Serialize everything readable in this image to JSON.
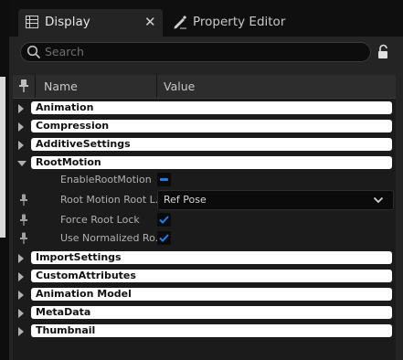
{
  "tabs": {
    "active": {
      "label": "Display",
      "close": "✕"
    },
    "inactive": {
      "label": "Property Editor"
    }
  },
  "search": {
    "placeholder": "Search",
    "value": ""
  },
  "table": {
    "header": {
      "name": "Name",
      "value": "Value"
    },
    "categories_top": [
      {
        "label": "Animation"
      },
      {
        "label": "Compression"
      },
      {
        "label": "AdditiveSettings"
      },
      {
        "label": "RootMotion",
        "expanded": true
      }
    ],
    "root_motion": {
      "enable_root_motion": {
        "label": "EnableRootMotion",
        "state": "indeterminate"
      },
      "root_motion_root_lock": {
        "label": "Root Motion Root L...",
        "value": "Ref Pose"
      },
      "force_root_lock": {
        "label": "Force Root Lock",
        "checked": true
      },
      "use_normalized_root": {
        "label": "Use Normalized Ro...",
        "checked": true
      }
    },
    "categories_bottom": [
      {
        "label": "ImportSettings"
      },
      {
        "label": "CustomAttributes"
      },
      {
        "label": "Animation Model"
      },
      {
        "label": "MetaData"
      },
      {
        "label": "Thumbnail"
      }
    ]
  },
  "colors": {
    "accent": "#1f7fe6",
    "panel": "#242424",
    "category_bar": "#ffffff"
  }
}
